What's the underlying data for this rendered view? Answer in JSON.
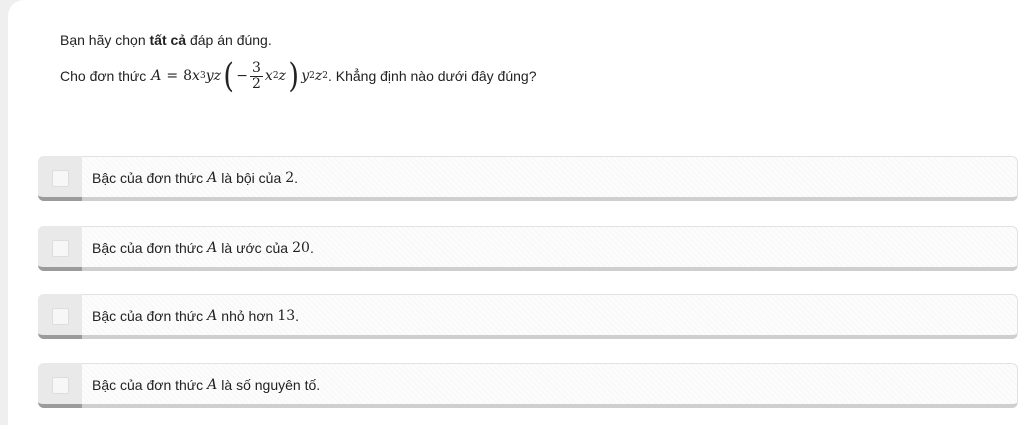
{
  "instruction": {
    "prefix": "Bạn hãy chọn ",
    "bold": "tất cả",
    "suffix": " đáp án đúng."
  },
  "question": {
    "prefix": "Cho đơn thức",
    "math": {
      "var": "A",
      "eq": "=",
      "coef": "8",
      "x": "x",
      "x_exp": "3",
      "yz": "yz",
      "minus": "−",
      "frac_num": "3",
      "frac_den": "2",
      "x2": "x",
      "x2_exp": "2",
      "z": "z",
      "y": "y",
      "y_exp": "2",
      "z2": "z",
      "z2_exp": "2"
    },
    "suffix": ". Khẳng định nào dưới đây đúng?"
  },
  "options": [
    {
      "prefix": "Bậc của đơn thức",
      "var": "A",
      "middle": "là bội của",
      "number": "2",
      "end": "."
    },
    {
      "prefix": "Bậc của đơn thức",
      "var": "A",
      "middle": "là ước của",
      "number": "20",
      "end": "."
    },
    {
      "prefix": "Bậc của đơn thức",
      "var": "A",
      "middle": "nhỏ hơn",
      "number": "13",
      "end": "."
    },
    {
      "prefix": "Bậc của đơn thức",
      "var": "A",
      "middle": "là số nguyên tố.",
      "number": "",
      "end": ""
    }
  ],
  "colors": {
    "page_background": "#efefef",
    "card_background": "#ffffff",
    "option_border_bottom": "#cfcfcf",
    "option_left_accent": "#9b9b9b",
    "text": "#222222"
  },
  "icons": {
    "option_checkbox": "empty-checkbox-icon"
  }
}
